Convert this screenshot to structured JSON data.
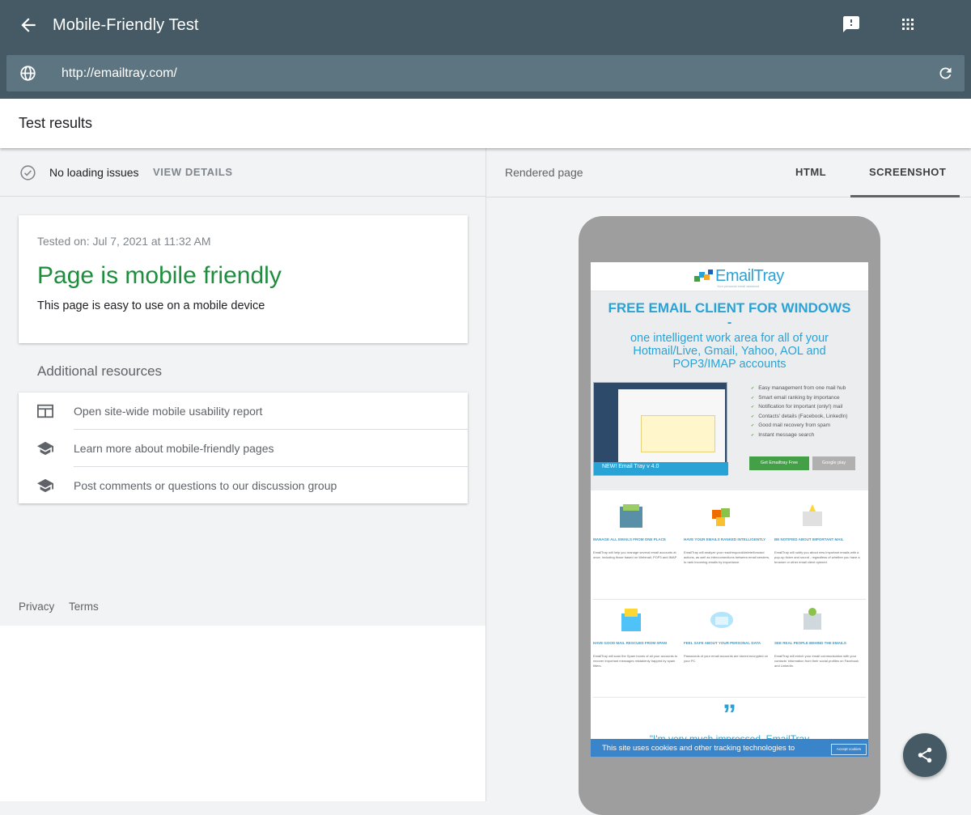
{
  "topbar": {
    "title": "Mobile-Friendly Test",
    "url_value": "http://emailtray.com/"
  },
  "results": {
    "title": "Test results"
  },
  "status": {
    "text": "No loading issues",
    "view_details": "VIEW DETAILS"
  },
  "card": {
    "tested_on": "Tested on: Jul 7, 2021 at 11:32 AM",
    "verdict": "Page is mobile friendly",
    "verdict_sub": "This page is easy to use on a mobile device",
    "verdict_color": "#1e8e3e"
  },
  "resources": {
    "heading": "Additional resources",
    "items": [
      {
        "label": "Open site-wide mobile usability report",
        "icon": "web-report-icon"
      },
      {
        "label": "Learn more about mobile-friendly pages",
        "icon": "school-icon"
      },
      {
        "label": "Post comments or questions to our discussion group",
        "icon": "school-icon"
      }
    ]
  },
  "footer": {
    "privacy": "Privacy",
    "terms": "Terms"
  },
  "rendered": {
    "label": "Rendered page",
    "tabs": [
      "HTML",
      "SCREENSHOT"
    ],
    "active_tab": "SCREENSHOT"
  },
  "preview": {
    "logo_name": "EmailTray",
    "logo_tag": "Your personal email assistant",
    "hero_title": "FREE EMAIL CLIENT FOR WINDOWS",
    "hero_dash": "-",
    "hero_sub": "one intelligent work area for all of your Hotmail/Live, Gmail, Yahoo, AOL and POP3/IMAP accounts",
    "ribbon": "NEW! Email Tray v 4.0",
    "features": [
      "Easy management from one mail hub",
      "Smart email ranking by importance",
      "Notification for important (only!) mail",
      "Contacts' details (Facebook, LinkedIn)",
      "Good mail recovery from spam",
      "Instant message search"
    ],
    "get_button": "Get Emailtray Free",
    "gplay_button": "Google play",
    "grid": [
      {
        "head": "MANAGE ALL EMAILS FROM ONE PLACE",
        "body": "EmailTray will help you manage several email accounts at once, including those based on Webmail, POP3 and IMAP"
      },
      {
        "head": "HAVE YOUR EMAILS RANKED INTELLIGENTLY",
        "body": "EmailTray will analyze your read/respond/delete/forward actions, as well as interconnections between email senders, to rank incoming emails by importance."
      },
      {
        "head": "BE NOTIFIED ABOUT IMPORTANT MAIL",
        "body": "EmailTray will notify you about new important emails with a pop-up ticker and sound - regardless of whether you have a browser or other email client opened."
      },
      {
        "head": "HAVE GOOD MAIL RESCUED FROM SPAM",
        "body": "EmailTray will scan the Spam boxes of all your accounts to recover important messages mistakenly trapped by spam filters."
      },
      {
        "head": "FEEL SAFE ABOUT YOUR PERSONAL DATA",
        "body": "Passwords of your email accounts are stored encrypted on your PC."
      },
      {
        "head": "SEE REAL PEOPLE BEHIND THE EMAILS",
        "body": "EmailTray will enrich your email communication with your contacts' information from their social profiles on Facebook and LinkedIn."
      }
    ],
    "quote_mark": "”",
    "quote_text": "\"I'm very much impressed. EmailTray",
    "cookie_text": "This site uses cookies and other tracking technologies to",
    "cookie_accept": "Accept cookies"
  },
  "colors": {
    "topbar": "#455a64",
    "urlbar": "#5d7580",
    "brand_blue": "#29a3d6",
    "success_green": "#1e8e3e"
  }
}
